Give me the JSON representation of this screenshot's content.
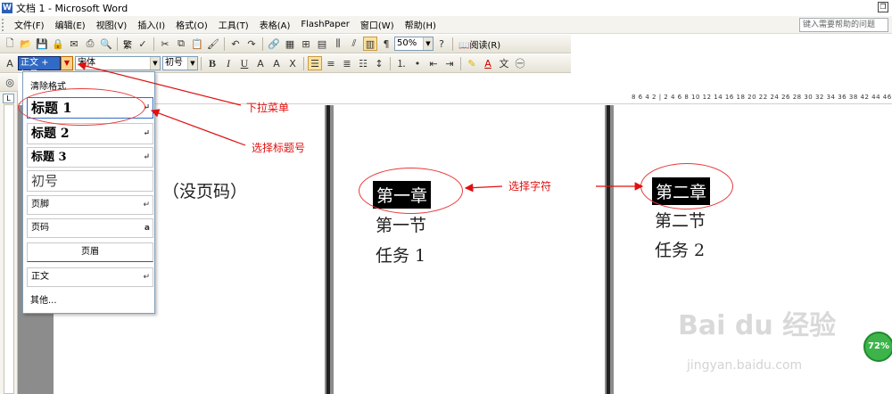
{
  "window": {
    "title": "文档 1 - Microsoft Word"
  },
  "menubar": {
    "items": [
      "文件(F)",
      "编辑(E)",
      "视图(V)",
      "插入(I)",
      "格式(O)",
      "工具(T)",
      "表格(A)",
      "FlashPaper",
      "窗口(W)",
      "帮助(H)"
    ],
    "help_placeholder": "键入需要帮助的问题"
  },
  "standard_toolbar": {
    "zoom": "50%",
    "read_label": "阅读(R)",
    "fanti_label": "繁"
  },
  "formatting_toolbar": {
    "style": "正文 + 初号",
    "font": "宋体",
    "size": "初号",
    "bold": "B",
    "italic": "I",
    "underline": "U",
    "char_border": "A",
    "char_shade": "A",
    "font_color": "A"
  },
  "ruler": {
    "numbers": "8 6 4 2 | 2 4 6 8 10 12 14 16 18 20 22 24 26 28 30 32 34 36 38  42 44 46 48"
  },
  "style_dropdown": {
    "items": [
      "清除格式",
      "标题 1",
      "标题 2",
      "标题 3",
      "初号",
      "页脚",
      "页码",
      "页眉",
      "正文",
      "其他..."
    ],
    "page_num_mark": "a",
    "return_mark": "↵"
  },
  "document": {
    "page1_text": "（没页码）",
    "page2": [
      "第一章",
      "第一节",
      "任务 1"
    ],
    "page3": [
      "第二章",
      "第二节",
      "任务 2"
    ]
  },
  "annotations": {
    "dropdown_menu": "下拉菜单",
    "select_heading": "选择标题号",
    "select_chars": "选择字符"
  },
  "watermark": {
    "main": "Bai du 经验",
    "url": "jingyan.baidu.com"
  },
  "badge": "72%"
}
